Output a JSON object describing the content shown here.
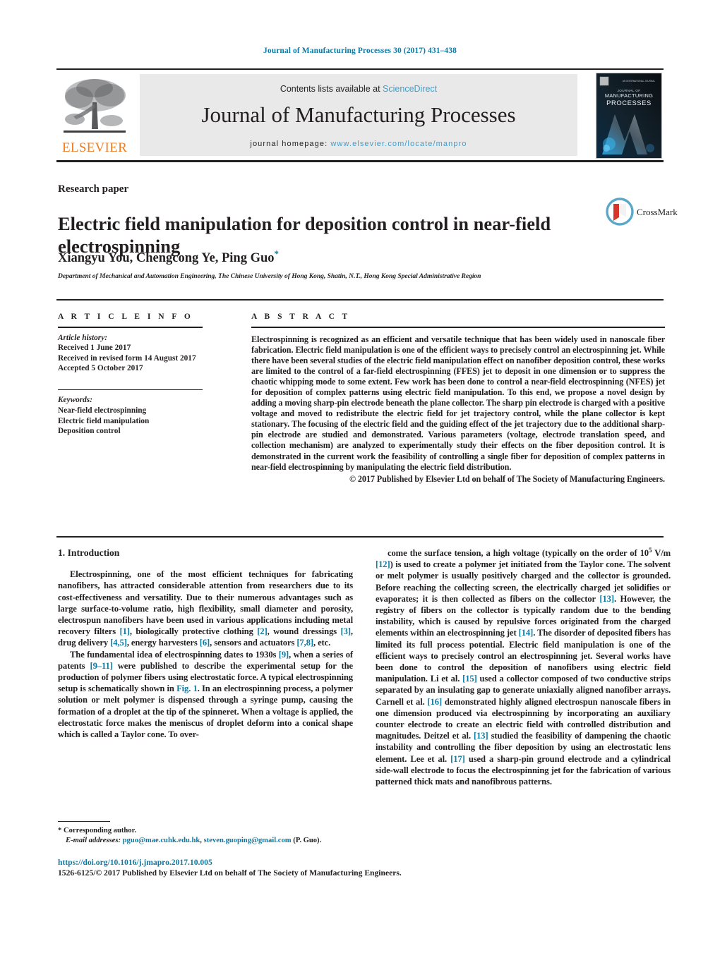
{
  "running_head": "Journal of Manufacturing Processes 30 (2017) 431–438",
  "masthead": {
    "contents_prefix": "Contents lists available at ",
    "sciencedirect": "ScienceDirect",
    "journal_title": "Journal of Manufacturing Processes",
    "homepage_prefix": "journal homepage: ",
    "homepage_url": "www.elsevier.com/locate/manpro",
    "publisher_wordmark": "ELSEVIER",
    "cover_title_line1": "JOURNAL OF",
    "cover_title_line2": "MANUFACTURING",
    "cover_title_line3": "PROCESSES",
    "colors": {
      "link_blue": "#3f9fd0",
      "elsevier_orange": "#ef7d22",
      "band_gray": "#e9e9e9"
    }
  },
  "article": {
    "type_label": "Research paper",
    "title": "Electric field manipulation for deposition control in near-field electrospinning",
    "authors": "Xiangyu You, Chengcong Ye, Ping Guo",
    "corresponding_marker": "*",
    "affiliation": "Department of Mechanical and Automation Engineering, The Chinese University of Hong Kong, Shatin, N.T., Hong Kong Special Administrative Region",
    "crossmark_label": "CrossMark"
  },
  "article_info": {
    "heading": "A R T I C L E   I N F O",
    "history_label": "Article history:",
    "history": [
      "Received 1 June 2017",
      "Received in revised form 14 August 2017",
      "Accepted 5 October 2017"
    ],
    "keywords_label": "Keywords:",
    "keywords": [
      "Near-field electrospinning",
      "Electric field manipulation",
      "Deposition control"
    ]
  },
  "abstract": {
    "heading": "A B S T R A C T",
    "body": "Electrospinning is recognized as an efficient and versatile technique that has been widely used in nanoscale fiber fabrication. Electric field manipulation is one of the efficient ways to precisely control an electrospinning jet. While there have been several studies of the electric field manipulation effect on nanofiber deposition control, these works are limited to the control of a far-field electrospinning (FFES) jet to deposit in one dimension or to suppress the chaotic whipping mode to some extent. Few work has been done to control a near-field electrospinning (NFES) jet for deposition of complex patterns using electric field manipulation. To this end, we propose a novel design by adding a moving sharp-pin electrode beneath the plane collector. The sharp pin electrode is charged with a positive voltage and moved to redistribute the electric field for jet trajectory control, while the plane collector is kept stationary. The focusing of the electric field and the guiding effect of the jet trajectory due to the additional sharp-pin electrode are studied and demonstrated. Various parameters (voltage, electrode translation speed, and collection mechanism) are analyzed to experimentally study their effects on the fiber deposition control. It is demonstrated in the current work the feasibility of controlling a single fiber for deposition of complex patterns in near-field electrospinning by manipulating the electric field distribution.",
    "copyright": "© 2017 Published by Elsevier Ltd on behalf of The Society of Manufacturing Engineers."
  },
  "body": {
    "section_number_title": "1.  Introduction",
    "left_paragraphs": [
      {
        "segments": [
          {
            "t": "Electrospinning, one of the most efficient techniques for fabricating nanofibers, has attracted considerable attention from researchers due to its cost-effectiveness and versatility. Due to their numerous advantages such as large surface-to-volume ratio, high flexibility, small diameter and porosity, electrospun nanofibers have been used in various applications including metal recovery filters "
          },
          {
            "t": "[1]",
            "ref": true
          },
          {
            "t": ", biologically protective clothing "
          },
          {
            "t": "[2]",
            "ref": true
          },
          {
            "t": ", wound dressings "
          },
          {
            "t": "[3]",
            "ref": true
          },
          {
            "t": ", drug delivery "
          },
          {
            "t": "[4,5]",
            "ref": true
          },
          {
            "t": ", energy harvesters "
          },
          {
            "t": "[6]",
            "ref": true
          },
          {
            "t": ", sensors and actuators "
          },
          {
            "t": "[7,8]",
            "ref": true
          },
          {
            "t": ", etc."
          }
        ]
      },
      {
        "segments": [
          {
            "t": "The fundamental idea of electrospinning dates to 1930s "
          },
          {
            "t": "[9]",
            "ref": true
          },
          {
            "t": ", when a series of patents "
          },
          {
            "t": "[9–11]",
            "ref": true
          },
          {
            "t": " were published to describe the experimental setup for the production of polymer fibers using electrostatic force. A typical electrospinning setup is schematically shown in "
          },
          {
            "t": "Fig. 1",
            "ref": true
          },
          {
            "t": ". In an electrospinning process, a polymer solution or melt polymer is dispensed through a syringe pump, causing the formation of a droplet at the tip of the spinneret. When a voltage is applied, the electrostatic force makes the meniscus of droplet deform into a conical shape which is called a Taylor cone. To over-"
          }
        ]
      }
    ],
    "right_paragraphs": [
      {
        "segments": [
          {
            "t": "come the surface tension, a high voltage (typically on the order of 10"
          },
          {
            "t": "5",
            "sup": true
          },
          {
            "t": " V/m "
          },
          {
            "t": "[12]",
            "ref": true
          },
          {
            "t": ") is used to create a polymer jet initiated from the Taylor cone. The solvent or melt polymer is usually positively charged and the collector is grounded. Before reaching the collecting screen, the electrically charged jet solidifies or evaporates; it is then collected as fibers on the collector "
          },
          {
            "t": "[13]",
            "ref": true
          },
          {
            "t": ". However, the registry of fibers on the collector is typically random due to the bending instability, which is caused by repulsive forces originated from the charged elements within an electrospinning jet "
          },
          {
            "t": "[14]",
            "ref": true
          },
          {
            "t": ". The disorder of deposited fibers has limited its full process potential. Electric field manipulation is one of the efficient ways to precisely control an electrospinning jet. Several works have been done to control the deposition of nanofibers using electric field manipulation. Li et al. "
          },
          {
            "t": "[15]",
            "ref": true
          },
          {
            "t": " used a collector composed of two conductive strips separated by an insulating gap to generate uniaxially aligned nanofiber arrays. Carnell et al. "
          },
          {
            "t": "[16]",
            "ref": true
          },
          {
            "t": " demonstrated highly aligned electrospun nanoscale fibers in one dimension produced via electrospinning by incorporating an auxiliary counter electrode to create an electric field with controlled distribution and magnitudes. Deitzel et al. "
          },
          {
            "t": "[13]",
            "ref": true
          },
          {
            "t": " studied the feasibility of dampening the chaotic instability and controlling the fiber deposition by using an electrostatic lens element. Lee et al. "
          },
          {
            "t": "[17]",
            "ref": true
          },
          {
            "t": " used a sharp-pin ground electrode and a cylindrical side-wall electrode to focus the electrospinning jet for the fabrication of various patterned thick mats and nanofibrous patterns."
          }
        ]
      }
    ]
  },
  "footnote": {
    "corresponding_author": "* Corresponding author.",
    "email_label": "E-mail addresses:",
    "email1": "pguo@mae.cuhk.edu.hk",
    "email_sep": ", ",
    "email2": "steven.guoping@gmail.com",
    "email_suffix": " (P. Guo)."
  },
  "footer": {
    "doi": "https://doi.org/10.1016/j.jmapro.2017.10.005",
    "issn_copyright": "1526-6125/© 2017 Published by Elsevier Ltd on behalf of The Society of Manufacturing Engineers."
  }
}
